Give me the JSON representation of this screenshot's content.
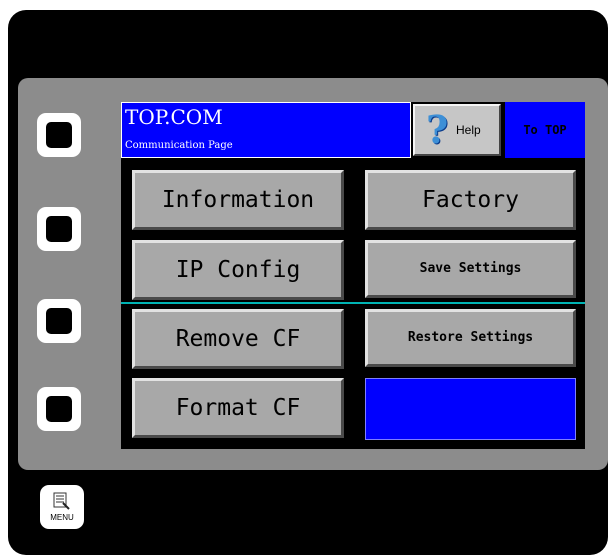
{
  "header": {
    "title": "TOP.COM",
    "subtitle": "Communication Page"
  },
  "help_button": {
    "label": "Help",
    "icon": "question-mark-icon"
  },
  "to_top_button": {
    "label": "To TOP"
  },
  "buttons": {
    "information": "Information",
    "factory": "Factory",
    "ip_config": "IP Config",
    "save_settings": "Save Settings",
    "remove_cf": "Remove CF",
    "restore_settings": "Restore Settings",
    "format_cf": "Format CF"
  },
  "menu_button": {
    "label": "MENU",
    "icon": "menu-list-icon"
  },
  "colors": {
    "screen_blue": "#0000ff",
    "button_gray": "#a8a8a8",
    "divider_teal": "#00b4b4",
    "bezel_gray": "#8c8c8c"
  }
}
